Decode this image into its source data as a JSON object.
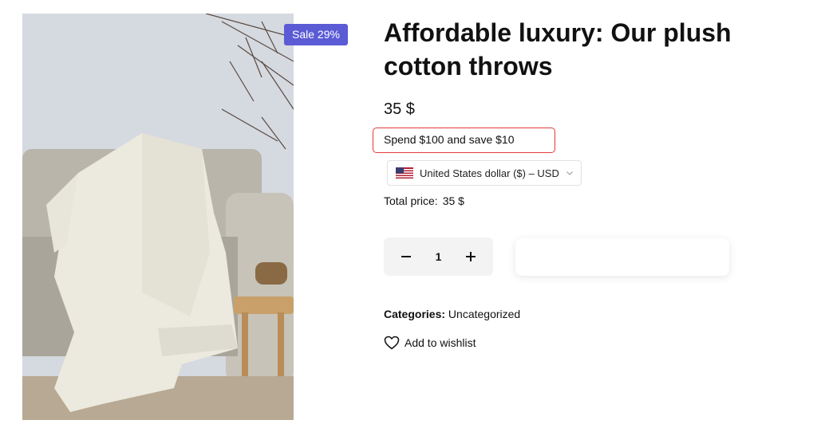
{
  "product": {
    "image_alt": "White knit throw blanket on a grey sofa",
    "sale_badge": "Sale 29%",
    "title": "Affordable luxury: Our plush cotton throws",
    "price": "35 $",
    "promo": "Spend $100 and save $10",
    "currency": {
      "selected": "United States dollar ($) – USD",
      "icon": "us-flag-icon"
    },
    "total": {
      "label": "Total price:",
      "value": "35 $"
    },
    "quantity": {
      "value": "1",
      "minus_icon": "minus-icon",
      "plus_icon": "plus-icon"
    },
    "add_to_cart_label": "",
    "categories": {
      "label": "Categories:",
      "value": "Uncategorized"
    },
    "wishlist": {
      "label": "Add to wishlist",
      "icon": "heart-icon"
    }
  },
  "colors": {
    "badge": "#5b5bd6",
    "promo_border": "#e23a3a"
  }
}
